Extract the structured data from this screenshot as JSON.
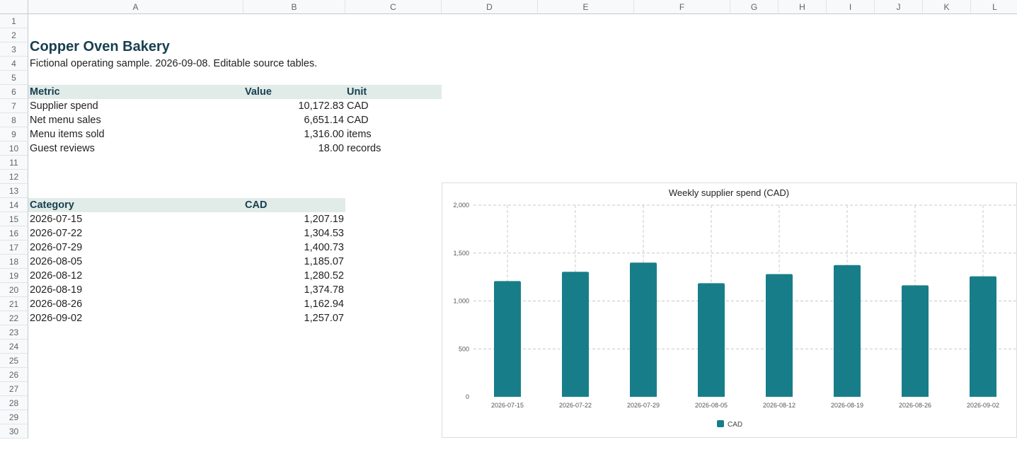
{
  "columns": [
    "A",
    "B",
    "C",
    "D",
    "E",
    "F",
    "G",
    "H",
    "I",
    "J",
    "K",
    "L"
  ],
  "rows": [
    "1",
    "2",
    "3",
    "4",
    "5",
    "6",
    "7",
    "8",
    "9",
    "10",
    "11",
    "12",
    "13",
    "14",
    "15",
    "16",
    "17",
    "18",
    "19",
    "20",
    "21",
    "22",
    "23",
    "24",
    "25",
    "26",
    "27",
    "28",
    "29",
    "30"
  ],
  "sheet_title": "Copper Oven Bakery",
  "subtitle": "Fictional operating sample. 2026-09-08. Editable source tables.",
  "summary": {
    "headers": [
      "Metric",
      "Value",
      "Unit"
    ],
    "rows": [
      {
        "metric": "Supplier spend",
        "value": "10,172.83",
        "unit": "CAD"
      },
      {
        "metric": "Net menu sales",
        "value": "6,651.14",
        "unit": "CAD"
      },
      {
        "metric": "Menu items sold",
        "value": "1,316.00",
        "unit": "items"
      },
      {
        "metric": "Guest reviews",
        "value": "18.00",
        "unit": "records"
      }
    ]
  },
  "weekly": {
    "headers": [
      "Category",
      "CAD"
    ],
    "rows": [
      {
        "category": "2026-07-15",
        "value": "1,207.19"
      },
      {
        "category": "2026-07-22",
        "value": "1,304.53"
      },
      {
        "category": "2026-07-29",
        "value": "1,400.73"
      },
      {
        "category": "2026-08-05",
        "value": "1,185.07"
      },
      {
        "category": "2026-08-12",
        "value": "1,280.52"
      },
      {
        "category": "2026-08-19",
        "value": "1,374.78"
      },
      {
        "category": "2026-08-26",
        "value": "1,162.94"
      },
      {
        "category": "2026-09-02",
        "value": "1,257.07"
      }
    ]
  },
  "chart_data": {
    "type": "bar",
    "title": "Weekly supplier spend (CAD)",
    "categories": [
      "2026-07-15",
      "2026-07-22",
      "2026-07-29",
      "2026-08-05",
      "2026-08-12",
      "2026-08-19",
      "2026-08-26",
      "2026-09-02"
    ],
    "series": [
      {
        "name": "CAD",
        "values": [
          1207.19,
          1304.53,
          1400.73,
          1185.07,
          1280.52,
          1374.78,
          1162.94,
          1257.07
        ],
        "color": "#177e89"
      }
    ],
    "ylim": [
      0,
      2000
    ],
    "yticks": [
      0,
      500,
      1000,
      1500,
      2000
    ],
    "ytick_labels": [
      "0",
      "500",
      "1,000",
      "1,500",
      "2,000"
    ],
    "grid": "dashed",
    "legend": "bottom"
  }
}
